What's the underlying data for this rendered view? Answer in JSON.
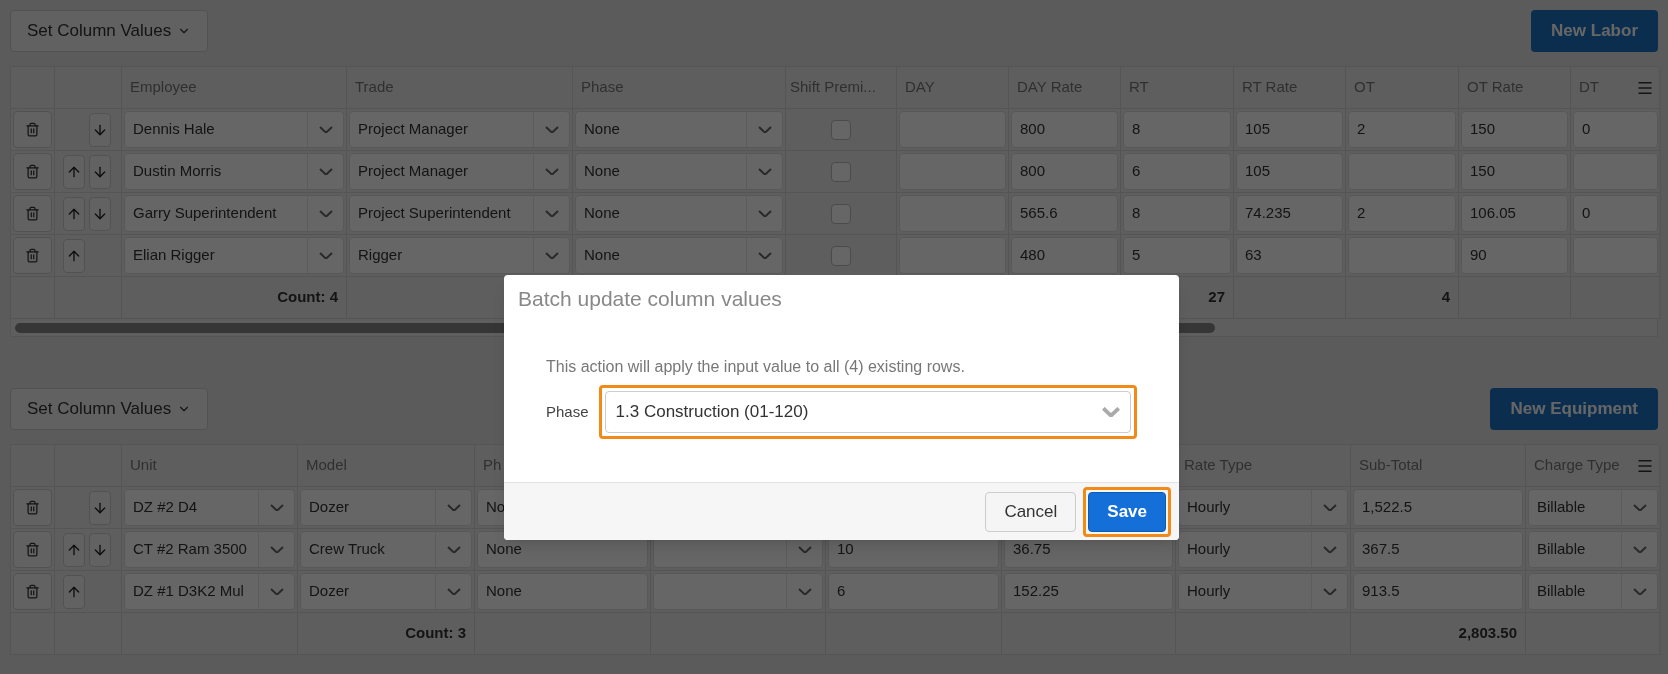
{
  "labor": {
    "kind": "labor",
    "set_values_button": "Set Column Values",
    "new_button": "New Labor",
    "columns": [
      {
        "kind": "delete"
      },
      {
        "kind": "move"
      },
      {
        "label": "Employee",
        "kind": "select",
        "footer": "Count: 4"
      },
      {
        "label": "Trade",
        "kind": "select"
      },
      {
        "label": "Phase",
        "kind": "select"
      },
      {
        "label": "Shift Premi...",
        "kind": "checkbox"
      },
      {
        "label": "DAY",
        "kind": "text"
      },
      {
        "label": "DAY Rate",
        "kind": "text"
      },
      {
        "label": "RT",
        "kind": "text",
        "footer": "27"
      },
      {
        "label": "RT Rate",
        "kind": "text"
      },
      {
        "label": "OT",
        "kind": "text",
        "footer": "4"
      },
      {
        "label": "OT Rate",
        "kind": "text"
      },
      {
        "label": "DT",
        "kind": "text"
      }
    ],
    "rows": [
      {
        "cells": [
          {
            "kind": "delete"
          },
          {
            "kind": "move",
            "can_move_up": false,
            "can_move_down": true
          },
          {
            "kind": "select",
            "value": "Dennis Hale"
          },
          {
            "kind": "select",
            "value": "Project Manager"
          },
          {
            "kind": "select",
            "value": "None"
          },
          {
            "kind": "checkbox",
            "checked": false
          },
          {
            "kind": "text"
          },
          {
            "kind": "text",
            "value": "800"
          },
          {
            "kind": "text",
            "value": "8"
          },
          {
            "kind": "text",
            "value": "105"
          },
          {
            "kind": "text",
            "value": "2"
          },
          {
            "kind": "text",
            "value": "150"
          },
          {
            "kind": "text",
            "value": "0"
          }
        ]
      },
      {
        "cells": [
          {
            "kind": "delete"
          },
          {
            "kind": "move",
            "can_move_up": true,
            "can_move_down": true
          },
          {
            "kind": "select",
            "value": "Dustin Morris"
          },
          {
            "kind": "select",
            "value": "Project Manager"
          },
          {
            "kind": "select",
            "value": "None"
          },
          {
            "kind": "checkbox",
            "checked": false
          },
          {
            "kind": "text"
          },
          {
            "kind": "text",
            "value": "800"
          },
          {
            "kind": "text",
            "value": "6"
          },
          {
            "kind": "text",
            "value": "105"
          },
          {
            "kind": "text"
          },
          {
            "kind": "text",
            "value": "150"
          },
          {
            "kind": "text"
          }
        ]
      },
      {
        "cells": [
          {
            "kind": "delete"
          },
          {
            "kind": "move",
            "can_move_up": true,
            "can_move_down": true
          },
          {
            "kind": "select",
            "value": "Garry Superintendent"
          },
          {
            "kind": "select",
            "value": "Project Superintendent"
          },
          {
            "kind": "select",
            "value": "None"
          },
          {
            "kind": "checkbox",
            "checked": false
          },
          {
            "kind": "text"
          },
          {
            "kind": "text",
            "value": "565.6"
          },
          {
            "kind": "text",
            "value": "8"
          },
          {
            "kind": "text",
            "value": "74.235"
          },
          {
            "kind": "text",
            "value": "2"
          },
          {
            "kind": "text",
            "value": "106.05"
          },
          {
            "kind": "text",
            "value": "0"
          }
        ]
      },
      {
        "cells": [
          {
            "kind": "delete"
          },
          {
            "kind": "move",
            "can_move_up": true,
            "can_move_down": false
          },
          {
            "kind": "select",
            "value": "Elian Rigger"
          },
          {
            "kind": "select",
            "value": "Rigger"
          },
          {
            "kind": "select",
            "value": "None"
          },
          {
            "kind": "checkbox",
            "checked": false
          },
          {
            "kind": "text"
          },
          {
            "kind": "text",
            "value": "480"
          },
          {
            "kind": "text",
            "value": "5"
          },
          {
            "kind": "text",
            "value": "63"
          },
          {
            "kind": "text"
          },
          {
            "kind": "text",
            "value": "90"
          },
          {
            "kind": "text"
          }
        ]
      }
    ]
  },
  "equipment": {
    "kind": "equipment",
    "set_values_button": "Set Column Values",
    "new_button": "New Equipment",
    "columns": [
      {
        "kind": "delete"
      },
      {
        "kind": "move"
      },
      {
        "label": "Unit",
        "kind": "select"
      },
      {
        "label": "Model",
        "kind": "select",
        "footer": "Count: 3"
      },
      {
        "label": "Ph",
        "kind": "text"
      },
      {
        "kind": "select"
      },
      {
        "kind": "text"
      },
      {
        "kind": "text"
      },
      {
        "label": "Rate Type",
        "kind": "select"
      },
      {
        "label": "Sub-Total",
        "kind": "text",
        "footer": "2,803.50"
      },
      {
        "label": "Charge Type",
        "kind": "select"
      }
    ],
    "rows": [
      {
        "cells": [
          {
            "kind": "delete"
          },
          {
            "kind": "move",
            "can_move_up": false,
            "can_move_down": true
          },
          {
            "kind": "select",
            "value": "DZ #2 D4"
          },
          {
            "kind": "select",
            "value": "Dozer"
          },
          {
            "kind": "text",
            "value": "No"
          },
          {
            "kind": "covered"
          },
          {
            "kind": "covered"
          },
          {
            "kind": "covered"
          },
          {
            "kind": "select",
            "value": "Hourly"
          },
          {
            "kind": "text",
            "value": "1,522.5"
          },
          {
            "kind": "select",
            "value": "Billable"
          }
        ]
      },
      {
        "cells": [
          {
            "kind": "delete"
          },
          {
            "kind": "move",
            "can_move_up": true,
            "can_move_down": true
          },
          {
            "kind": "select",
            "value": "CT #2 Ram 3500"
          },
          {
            "kind": "select",
            "value": "Crew Truck"
          },
          {
            "kind": "text",
            "value": "None"
          },
          {
            "kind": "select"
          },
          {
            "kind": "text",
            "value": "10"
          },
          {
            "kind": "text",
            "value": "36.75"
          },
          {
            "kind": "select",
            "value": "Hourly"
          },
          {
            "kind": "text",
            "value": "367.5"
          },
          {
            "kind": "select",
            "value": "Billable"
          }
        ]
      },
      {
        "cells": [
          {
            "kind": "delete"
          },
          {
            "kind": "move",
            "can_move_up": true,
            "can_move_down": false
          },
          {
            "kind": "select",
            "value": "DZ #1 D3K2 Mul"
          },
          {
            "kind": "select",
            "value": "Dozer"
          },
          {
            "kind": "text",
            "value": "None"
          },
          {
            "kind": "select"
          },
          {
            "kind": "text",
            "value": "6"
          },
          {
            "kind": "text",
            "value": "152.25"
          },
          {
            "kind": "select",
            "value": "Hourly"
          },
          {
            "kind": "text",
            "value": "913.5"
          },
          {
            "kind": "select",
            "value": "Billable"
          }
        ]
      }
    ]
  },
  "dialog": {
    "title": "Batch update column values",
    "message": "This action will apply the input value to all (4) existing rows.",
    "field_label": "Phase",
    "field_value": "1.3 Construction (01-120)",
    "field_highlighted": true,
    "buttons": [
      {
        "kind": "cancel",
        "label": "Cancel",
        "highlighted": false
      },
      {
        "kind": "save",
        "label": "Save",
        "highlighted": true
      }
    ]
  }
}
